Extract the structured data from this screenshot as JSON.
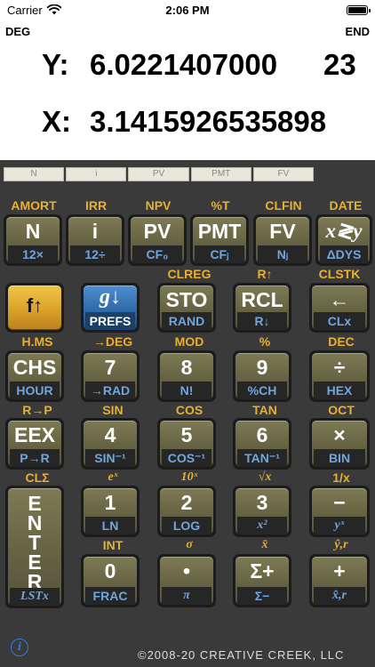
{
  "status_bar": {
    "carrier": "Carrier",
    "time": "2:06 PM"
  },
  "display": {
    "angle_mode": "DEG",
    "entry_mode": "END",
    "y_label": "Y:",
    "y_value": "6.0221407000",
    "y_exponent": "23",
    "x_label": "X:",
    "x_value": "3.1415926535898"
  },
  "financial_registers": [
    "N",
    "i",
    "PV",
    "PMT",
    "FV"
  ],
  "top_labels": {
    "r1": [
      "AMORT",
      "IRR",
      "NPV",
      "%T",
      "CLFIN",
      "DATE"
    ],
    "r2": [
      "CLREG",
      "R↑",
      "CLSTK"
    ],
    "r3": [
      "H.MS",
      "→DEG",
      "MOD",
      "%",
      "DEC"
    ],
    "r4": [
      "R→P",
      "SIN",
      "COS",
      "TAN",
      "OCT"
    ],
    "r5": [
      "CLΣ",
      "eˣ",
      "10ˣ",
      "√x",
      "1/x"
    ],
    "r6": [
      "INT",
      "σ",
      "x̄",
      "ŷ,r"
    ]
  },
  "keys": {
    "n": {
      "main": "N",
      "sub": "12×"
    },
    "i": {
      "main": "i",
      "sub": "12÷"
    },
    "pv": {
      "main": "PV",
      "sub": "CF₀"
    },
    "pmt": {
      "main": "PMT",
      "sub": "CFⱼ"
    },
    "fv": {
      "main": "FV",
      "sub": "Nⱼ"
    },
    "swap": {
      "main": "x≷y",
      "sub": "ΔDYS"
    },
    "f": {
      "main": "f↑"
    },
    "g": {
      "main": "g↓",
      "sub": "PREFS"
    },
    "sto": {
      "main": "STO",
      "sub": "RAND"
    },
    "rcl": {
      "main": "RCL",
      "sub": "R↓"
    },
    "back": {
      "main": "←",
      "sub": "CLx"
    },
    "chs": {
      "main": "CHS",
      "sub": "HOUR"
    },
    "seven": {
      "main": "7",
      "sub": "→RAD"
    },
    "eight": {
      "main": "8",
      "sub": "N!"
    },
    "nine": {
      "main": "9",
      "sub": "%CH"
    },
    "divide": {
      "main": "÷",
      "sub": "HEX"
    },
    "eex": {
      "main": "EEX",
      "sub": "P→R"
    },
    "four": {
      "main": "4",
      "sub": "SIN⁻¹"
    },
    "five": {
      "main": "5",
      "sub": "COS⁻¹"
    },
    "six": {
      "main": "6",
      "sub": "TAN⁻¹"
    },
    "times": {
      "main": "×",
      "sub": "BIN"
    },
    "enter": {
      "main": "E\nN\nT\nE\nR",
      "sub": "LSTx"
    },
    "one": {
      "main": "1",
      "sub": "LN"
    },
    "two": {
      "main": "2",
      "sub": "LOG"
    },
    "three": {
      "main": "3",
      "sub": "x²"
    },
    "minus": {
      "main": "−",
      "sub": "yˣ"
    },
    "zero": {
      "main": "0",
      "sub": "FRAC"
    },
    "dot": {
      "main": "•",
      "sub": "π"
    },
    "sigma": {
      "main": "Σ+",
      "sub": "Σ−"
    },
    "plus": {
      "main": "+",
      "sub": "x̂,r"
    }
  },
  "footer": {
    "copyright": "©2008-20 CREATIVE CREEK, LLC"
  },
  "icons": {
    "info": "i"
  },
  "colors": {
    "shift_gold": "#e8b030",
    "shift_blue": "#6fa6dd",
    "key_olive": "#6a6746",
    "body": "#3a3a3a"
  }
}
